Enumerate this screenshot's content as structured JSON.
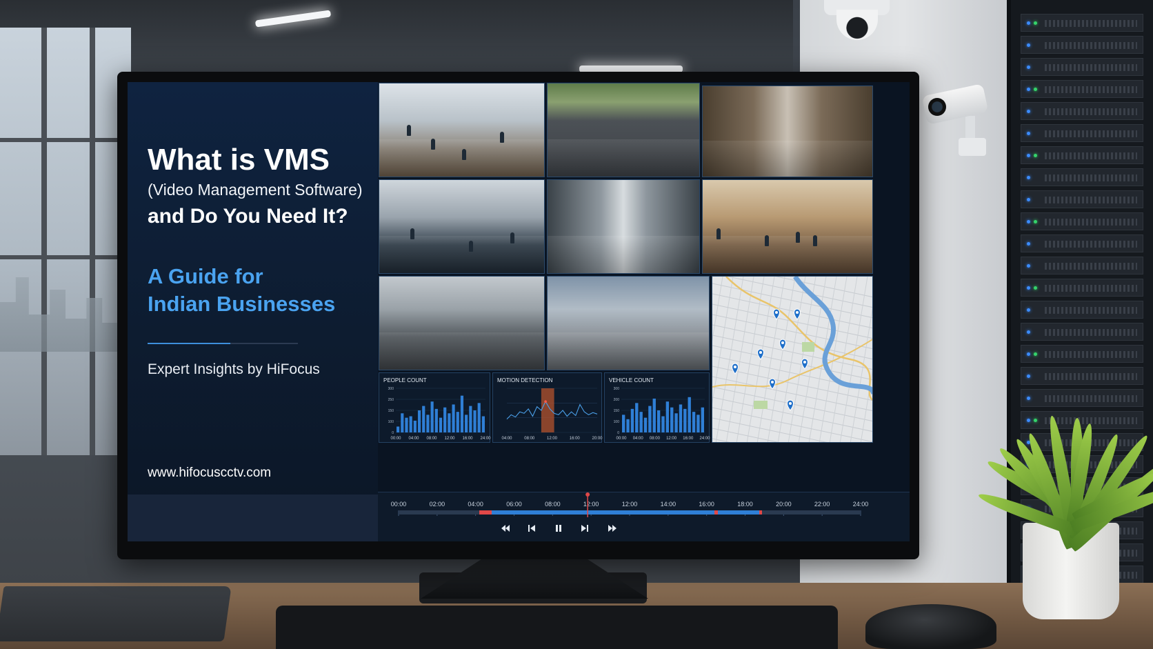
{
  "slide": {
    "title": "What is VMS",
    "subtitle": "(Video Management Software)",
    "question": "and Do You Need It?",
    "guide_line1": "A Guide for",
    "guide_line2": "Indian Businesses",
    "insights": "Expert Insights by HiFocus",
    "website": "www.hifocuscctv.com"
  },
  "camera_feeds": [
    {
      "scene": "lobby-reception"
    },
    {
      "scene": "parking-lot"
    },
    {
      "scene": "warehouse-aisle"
    },
    {
      "scene": "open-office"
    },
    {
      "scene": "corridor"
    },
    {
      "scene": "retail-floor"
    },
    {
      "scene": "street-traffic"
    },
    {
      "scene": "building-entrance"
    }
  ],
  "map": {
    "pins": 8
  },
  "chart_data": [
    {
      "type": "bar",
      "title": "PEOPLE COUNT",
      "categories": [
        "00:00",
        "04:00",
        "08:00",
        "12:00",
        "16:00",
        "24:00"
      ],
      "y_ticks": [
        "300",
        "250",
        "150",
        "100",
        "0"
      ],
      "ylim": [
        0,
        300
      ],
      "values": [
        40,
        130,
        100,
        110,
        80,
        150,
        180,
        120,
        210,
        160,
        100,
        170,
        130,
        190,
        140,
        250,
        120,
        180,
        150,
        200,
        110
      ],
      "bar_color": "#2f7fd6"
    },
    {
      "type": "line",
      "title": "MOTION DETECTION",
      "categories": [
        "04:00",
        "08:00",
        "12:00",
        "16:00",
        "20:00"
      ],
      "ylim": [
        0,
        300
      ],
      "values": [
        90,
        120,
        105,
        140,
        130,
        160,
        110,
        175,
        150,
        210,
        160,
        130,
        120,
        150,
        110,
        140,
        115,
        190,
        140,
        120,
        135,
        125
      ],
      "highlight_range": [
        8,
        11
      ],
      "line_color": "#4a9fe8",
      "highlight_color": "#b4532e"
    },
    {
      "type": "bar",
      "title": "VEHICLE COUNT",
      "categories": [
        "00:00",
        "04:00",
        "08:00",
        "12:00",
        "16:00",
        "24:00"
      ],
      "y_ticks": [
        "300",
        "200",
        "150",
        "100",
        "0"
      ],
      "ylim": [
        0,
        300
      ],
      "values": [
        120,
        90,
        160,
        200,
        140,
        100,
        180,
        230,
        150,
        110,
        210,
        170,
        130,
        190,
        160,
        240,
        140,
        120,
        170
      ],
      "bar_color": "#2f7fd6"
    }
  ],
  "timeline": {
    "labels": [
      "00:00",
      "02:00",
      "04:00",
      "06:00",
      "08:00",
      "12:00",
      "12:00",
      "14:00",
      "16:00",
      "18:00",
      "20:00",
      "22:00",
      "24:00"
    ],
    "playhead": "12:00",
    "controls": [
      "rewind",
      "previous",
      "pause",
      "next",
      "fast-forward"
    ],
    "accent": "#2f7fd6",
    "alert": "#e04848"
  }
}
